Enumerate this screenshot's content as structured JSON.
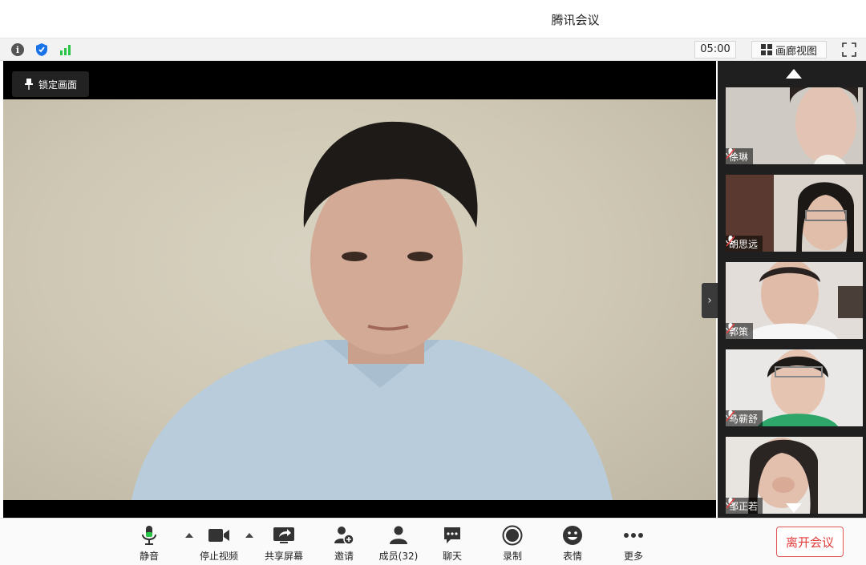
{
  "window": {
    "title": "腾讯会议"
  },
  "infobar": {
    "icons": [
      "info-icon",
      "shield-icon",
      "signal-icon"
    ],
    "timer": "05:00",
    "gallery_label": "画廊视图"
  },
  "main": {
    "lock_label": "锁定画面"
  },
  "participants": [
    {
      "name": "徐琳"
    },
    {
      "name": "胡思远"
    },
    {
      "name": "郭策"
    },
    {
      "name": "马蕲舒"
    },
    {
      "name": "邹正若"
    }
  ],
  "toolbar": {
    "mute": "静音",
    "stop_video": "停止视频",
    "share_screen": "共享屏幕",
    "invite": "邀请",
    "members": "成员(32)",
    "chat": "聊天",
    "record": "录制",
    "emoji": "表情",
    "more": "更多",
    "leave": "离开会议"
  },
  "colors": {
    "accent_green": "#28c445",
    "shield_blue": "#1a73e8",
    "leave_red": "#e03a3a"
  }
}
